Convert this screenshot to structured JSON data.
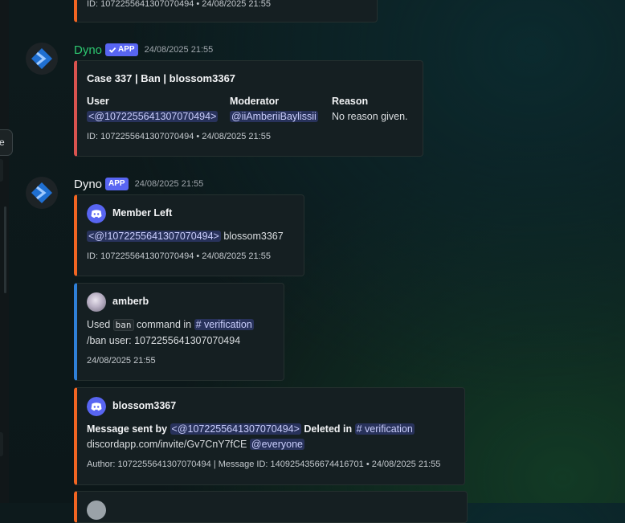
{
  "top_embed": {
    "footer": "ID: 1072255641307070494 • 24/08/2025 21:55"
  },
  "message1": {
    "author": "Dyno",
    "badge": "APP",
    "timestamp": "24/08/2025 21:55",
    "embed": {
      "title": "Case 337 | Ban | blossom3367",
      "fields": [
        {
          "name": "User",
          "value": "<@1072255641307070494>"
        },
        {
          "name": "Moderator",
          "value": "@iiAmberiiBaylissii"
        },
        {
          "name": "Reason",
          "value": "No reason given."
        }
      ],
      "footer": "ID: 1072255641307070494 • 24/08/2025 21:55"
    }
  },
  "message2": {
    "author": "Dyno",
    "badge": "APP",
    "timestamp": "24/08/2025 21:55",
    "embed1": {
      "author": "Member Left",
      "mention": "<@!1072255641307070494>",
      "desc_rest": "blossom3367",
      "footer": "ID: 1072255641307070494 • 24/08/2025 21:55"
    },
    "embed2": {
      "author": "amberb",
      "used": "Used",
      "command": "ban",
      "command_in": "command in",
      "channel": "# verification",
      "line2": "/ban user: 1072255641307070494",
      "footer": "24/08/2025 21:55"
    },
    "embed3": {
      "author": "blossom3367",
      "msg_sent_by": "Message sent by",
      "mention": "<@1072255641307070494>",
      "deleted_in": "Deleted in",
      "channel": "# verification",
      "invite": "discordapp.com/invite/Gv7CnY7fCE",
      "everyone": "@everyone",
      "footer": "Author: 1072255641307070494 | Message ID: 1409254356674416701 • 24/08/2025 21:55"
    }
  },
  "tooltip_fragment": "e",
  "colors": {
    "accent_orange": "#f26522",
    "accent_red": "#d9534f",
    "accent_blue": "#2f80d8",
    "dyno_green": "#2dc770",
    "badge_blurple": "#5865f2"
  }
}
